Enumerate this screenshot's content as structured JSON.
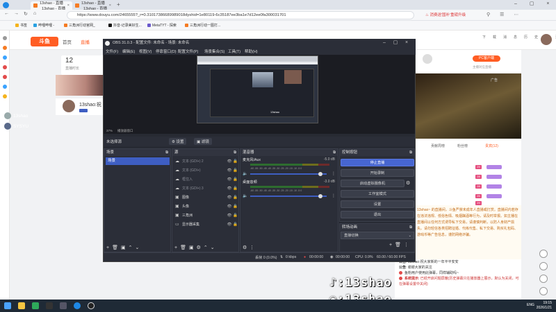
{
  "browser": {
    "tabs": [
      {
        "label": "13shao - 直播_13shao - 直播"
      },
      {
        "label": "13shao - 直播_13shao - 直播"
      }
    ],
    "url": "https://www.douyu.com/2465555?_r=0.31017386689989018dyshid=1e80119-6c35187ee3ba1e7d12ee0fa300031701",
    "promo": "消费送'国补'重磅升级",
    "bookmarks": [
      "书签",
      "哔哩哔哩 -",
      "三角洲行动官网_",
      "抖音-记录美好生...",
      "MetaTYT - 探索",
      "三角洲行动一图打..."
    ]
  },
  "douyu": {
    "nav": [
      "首页",
      "直播"
    ],
    "stat_number": "12",
    "stat_label": "直播时长",
    "anchor_name": "13shao:祝",
    "right_labels": [
      "下载",
      "消息",
      "历史",
      "关注"
    ],
    "pc_client_label": "PC客户端",
    "pc_client_sub": "主播对应直播",
    "ad_label": "广告",
    "rank_tabs": [
      "贡献周榜",
      "粉丝榜",
      "贵宾(12)"
    ],
    "rank_badges": [
      "29",
      "28",
      "28",
      "25",
      "29"
    ],
    "notice": "13shao~ 的直播间，斗鱼严禁未成年人直播或打赏。直播间内若存在违法违规、低俗色情、吸烟酗酒等行为，请及时举报。如主播在直播间以任何方式诱导私下交易，请谨慎判断，以防人身财产损失。请勿轻信各类招聘征婚、代练代售、私下交易、购买礼包码、游戏币等广告信息，谨防网络诈骗。",
    "chat": [
      {
        "who": "公告",
        "text": "13shao:祝大家新的一年平平安安"
      },
      {
        "who": "公告",
        "text": "谢谢大家的关注"
      },
      {
        "who": "",
        "text": "鱼粉用户使用此弹幕，同样辅助吗~"
      },
      {
        "who": "系统提示",
        "text": "已经开启问题屏蔽(历史弹幕只在播放器上展示，默认为关闭，可在弹幕设置中关闭)"
      }
    ],
    "users": [
      "13shao",
      "SYSYU"
    ],
    "brand_tiktok": "13shao",
    "brand_douyu": "13shao"
  },
  "obs": {
    "title": "OBS 31.0.3 - 配置文件: 未命名 - 场景: 未命名",
    "menu": [
      "文件(F)",
      "编辑(E)",
      "视图(V)",
      "停靠窗口(D)",
      "配置文件(P)",
      "场景集合(S)",
      "工具(T)",
      "帮助(H)"
    ],
    "zoom": "37%",
    "preview_label": "播放器窗口",
    "status_no_source": "未选择源",
    "btn_properties": "设置",
    "btn_filters": "滤镜",
    "panel_scenes": "场景",
    "panel_sources": "源",
    "panel_mixer": "混音器",
    "panel_controls": "控制按钮",
    "panel_transitions": "转场动画",
    "scene_selected": "场景",
    "sources": [
      {
        "label": "文本 (GDI+) 2",
        "icon": "text-icon"
      },
      {
        "label": "文本 (GDI+)",
        "icon": "text-icon"
      },
      {
        "label": "框住入",
        "icon": "text-icon"
      },
      {
        "label": "文本 (GDI+) 3",
        "icon": "text-icon"
      },
      {
        "label": "图像",
        "icon": "image-icon"
      },
      {
        "label": "头像",
        "icon": "image-icon"
      },
      {
        "label": "三角洲",
        "icon": "image-icon"
      },
      {
        "label": "显示器采集",
        "icon": "monitor-icon"
      }
    ],
    "mixer": [
      {
        "name": "麦克风/Aux",
        "db": "-5.0 dB"
      },
      {
        "name": "桌面音频",
        "db": "-3.0 dB"
      }
    ],
    "meter_ticks": "-60 -55 -50 -45 -40 -35 -30 -25 -20 -15 -10 -5 0",
    "controls": [
      "停止直播",
      "开始录制",
      "启动虚拟摄像机",
      "工作室模式",
      "设置",
      "退出"
    ],
    "transition": "直接切换",
    "status": {
      "dropped": "丢帧 0 (0.0%)",
      "bitrate": "0 kbps",
      "live": "00:00:00",
      "rec": "00:00:00",
      "cpu": "CPU: 0.9%",
      "fps": "60.00 / 60.00 FPS"
    }
  },
  "taskbar": {
    "time": "19:15",
    "date": "2026/1/21",
    "lang": "ENG"
  }
}
